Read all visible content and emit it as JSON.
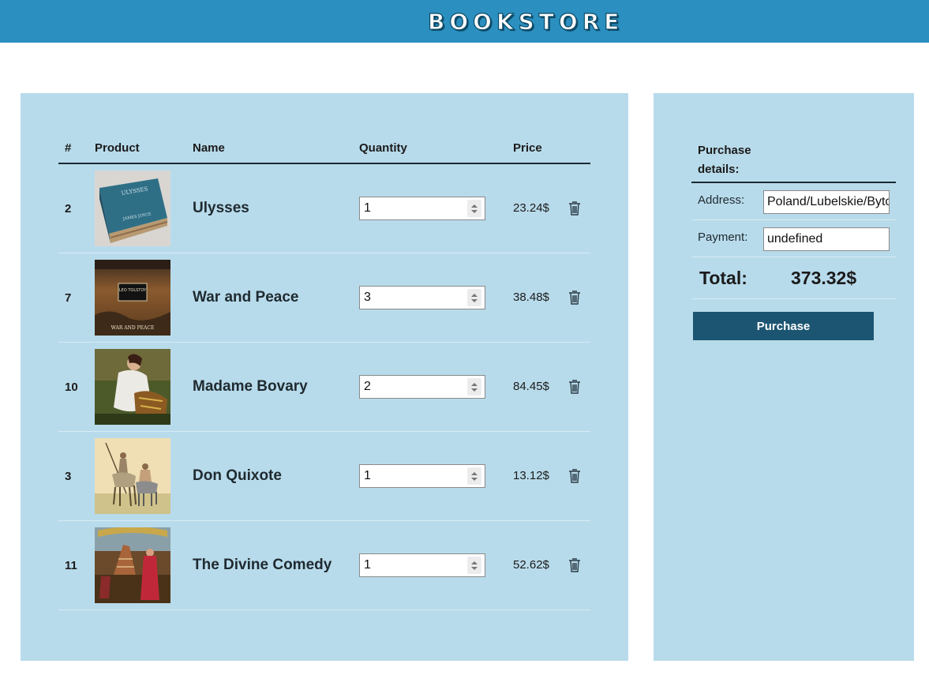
{
  "header": {
    "title": "BOOKSTORE",
    "brand_color": "#2b8fbf"
  },
  "cart": {
    "columns": [
      "#",
      "Product",
      "Name",
      "Quantity",
      "Price"
    ],
    "rows": [
      {
        "id": "2",
        "name": "Ulysses",
        "quantity": "1",
        "price": "23.24$",
        "cover": "ulysses-cover"
      },
      {
        "id": "7",
        "name": "War and Peace",
        "quantity": "3",
        "price": "38.48$",
        "cover": "war-and-peace-cover"
      },
      {
        "id": "10",
        "name": "Madame Bovary",
        "quantity": "2",
        "price": "84.45$",
        "cover": "madame-bovary-cover"
      },
      {
        "id": "3",
        "name": "Don Quixote",
        "quantity": "1",
        "price": "13.12$",
        "cover": "don-quixote-cover"
      },
      {
        "id": "11",
        "name": "The Divine Comedy",
        "quantity": "1",
        "price": "52.62$",
        "cover": "divine-comedy-cover"
      }
    ],
    "row_action_icon": "trash-icon"
  },
  "details": {
    "heading": "Purchase details:",
    "address_label": "Address:",
    "address_value": "Poland/Lubelskie/Bytom",
    "payment_label": "Payment:",
    "payment_value": "undefined",
    "total_label": "Total:",
    "total_value": "373.32$",
    "purchase_label": "Purchase",
    "button_color": "#1b5572"
  },
  "panel_color": "#b8dbeb"
}
